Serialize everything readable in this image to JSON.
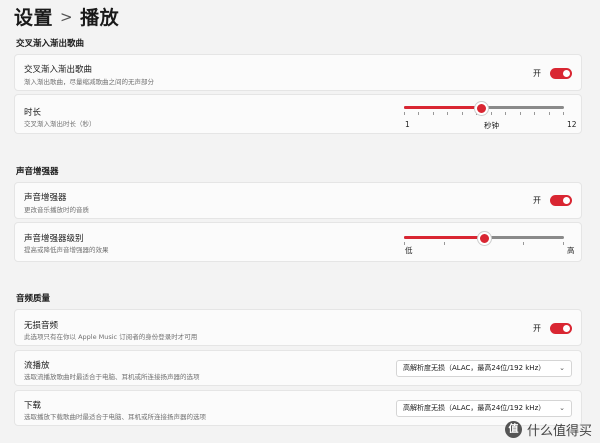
{
  "breadcrumb": {
    "parent": "设置",
    "separator": ">",
    "current": "播放"
  },
  "crossfade": {
    "section_title": "交叉渐入渐出歌曲",
    "toggle_row": {
      "title": "交叉渐入渐出歌曲",
      "desc": "渐入渐出歌曲，尽量缩减歌曲之间的无声部分",
      "state": "开",
      "on": true
    },
    "duration_row": {
      "title": "时长",
      "desc": "交叉渐入渐出时长（秒）",
      "min_label": "1",
      "unit_label": "秒钟",
      "max_label": "12",
      "value_fraction": 0.48
    }
  },
  "enhancer": {
    "section_title": "声音增强器",
    "toggle_row": {
      "title": "声音增强器",
      "desc": "更改音乐播放时的音质",
      "state": "开",
      "on": true
    },
    "level_row": {
      "title": "声音增强器级别",
      "desc": "提高或降低声音增强器的效果",
      "min_label": "低",
      "max_label": "高",
      "value_fraction": 0.5
    }
  },
  "quality": {
    "section_title": "音频质量",
    "lossless_row": {
      "title": "无损音频",
      "desc": "此选项只有在你以 Apple Music 订阅者的身份登录时才可用",
      "state": "开",
      "on": true
    },
    "streaming_row": {
      "title": "流播放",
      "desc": "选取流播放歌曲时最适合于电脑、耳机或所连接扬声器的选项",
      "selected": "高解析度无损（ALAC，最高24位/192 kHz）"
    },
    "download_row": {
      "title": "下载",
      "desc": "选取播放下载歌曲时最适合于电脑、耳机或所连接扬声器的选项",
      "selected": "高解析度无损（ALAC，最高24位/192 kHz）"
    }
  },
  "watermark": {
    "logo_char": "值",
    "text": "什么值得买"
  },
  "colors": {
    "accent": "#d92632"
  },
  "icons": {
    "chevron": "chevron-down-icon"
  }
}
